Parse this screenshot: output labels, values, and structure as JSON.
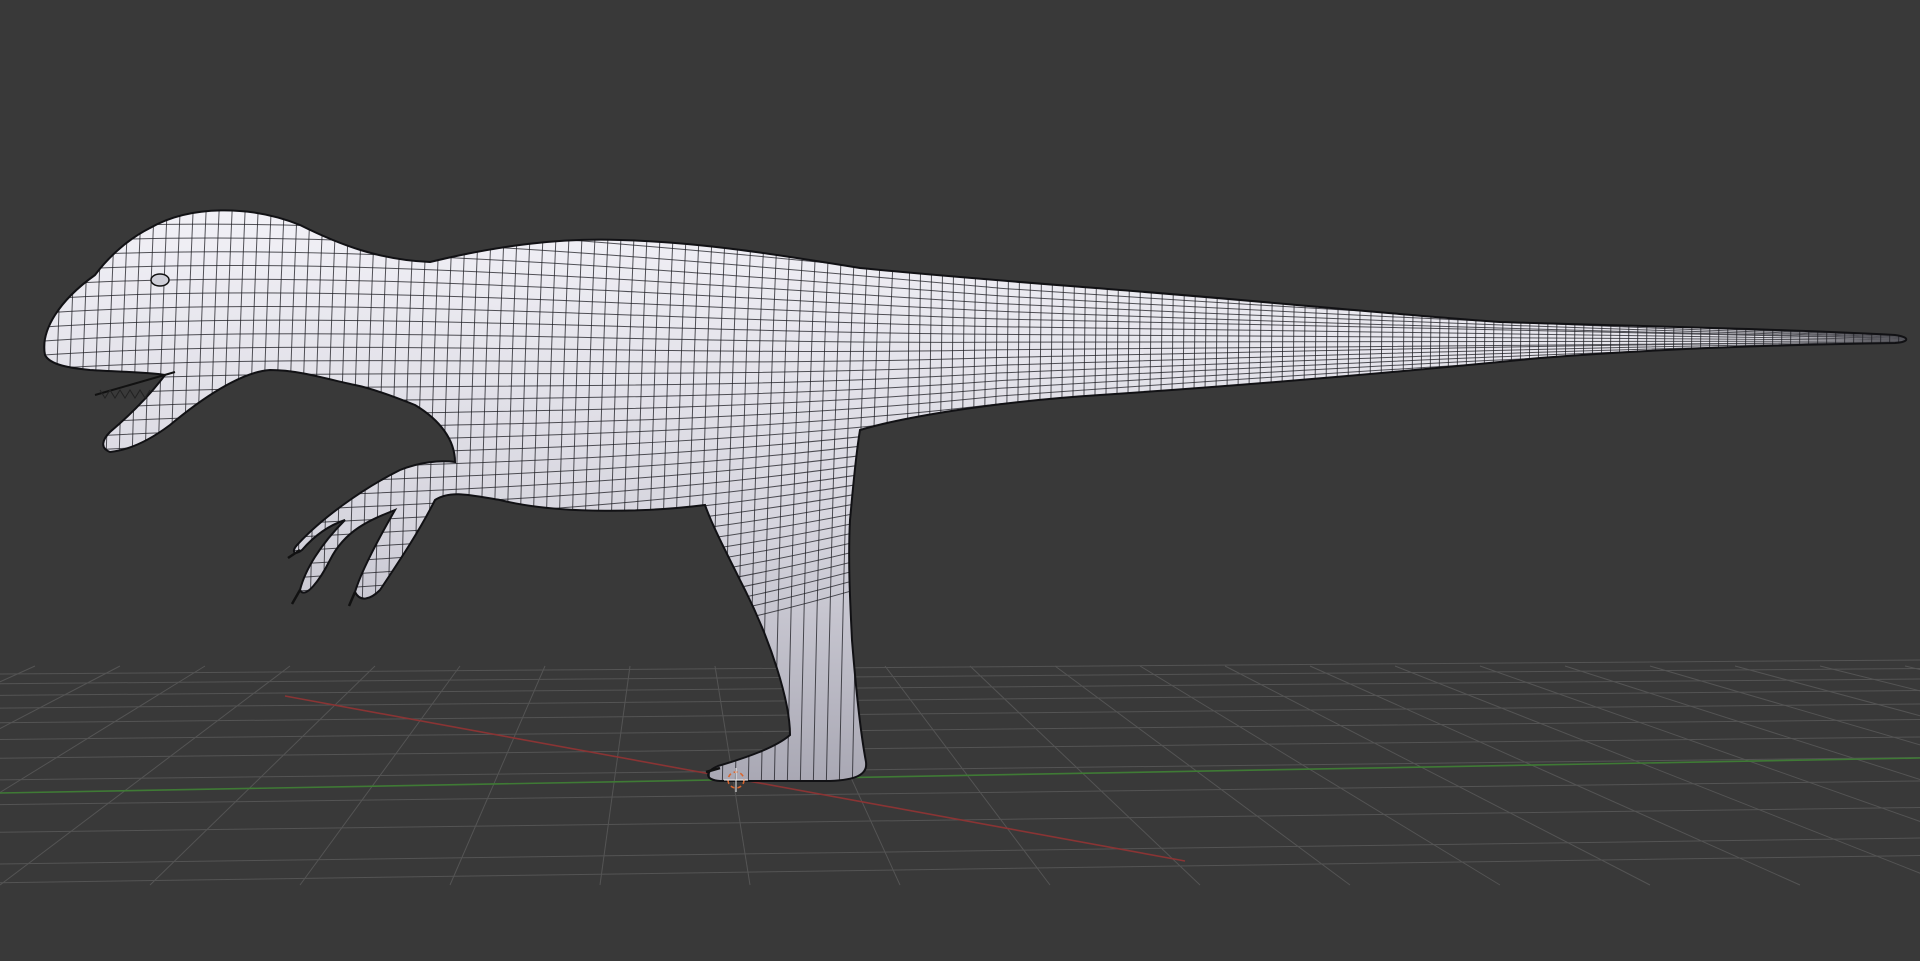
{
  "viewport": {
    "name": "3D Viewport",
    "background": "#393939",
    "grid_color": "#545454",
    "x_axis_color": "#8a3434",
    "y_axis_color": "#3f7a35",
    "cursor_color": "#d9652d"
  },
  "model": {
    "name": "dinosaur-mesh",
    "fill_color": "#d9d8e0",
    "wire_color": "#1c1c22"
  }
}
